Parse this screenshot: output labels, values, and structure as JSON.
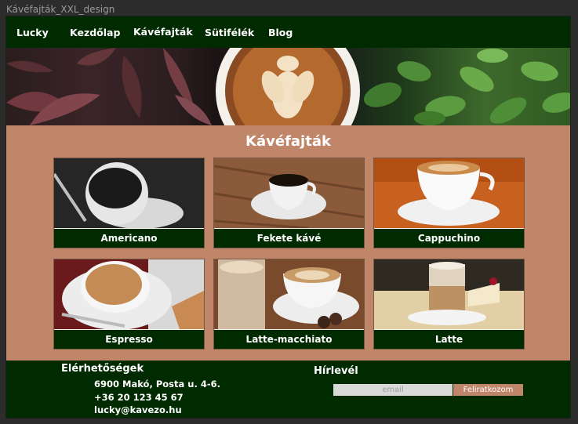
{
  "window": {
    "title": "Kávéfajták_XXL_design"
  },
  "nav": {
    "brand": "Lucky",
    "items": [
      "Kezdőlap",
      "Kávéfajták",
      "Sütifélék",
      "Blog"
    ]
  },
  "main": {
    "title": "Kávéfajták",
    "cards": [
      {
        "label": "Americano"
      },
      {
        "label": "Fekete kávé"
      },
      {
        "label": "Cappuchino"
      },
      {
        "label": "Espresso"
      },
      {
        "label": "Latte-macchiato"
      },
      {
        "label": "Latte"
      }
    ]
  },
  "footer": {
    "contact_title": "Elérhetőségek",
    "address": "6900 Makó, Posta u. 4-6.",
    "phone": "+36 20 123 45 67",
    "email": "lucky@kavezo.hu",
    "newsletter_title": "Hírlevél",
    "email_placeholder": "email",
    "subscribe_label": "Feliratkozom"
  },
  "colors": {
    "nav_bg": "#002b00",
    "body_bg": "#c0866a",
    "caption_bg": "#002b00",
    "button_bg": "#c0866a"
  }
}
